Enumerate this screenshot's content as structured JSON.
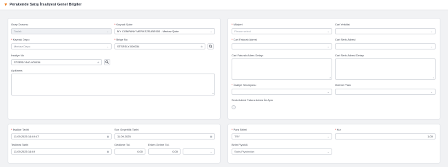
{
  "header": {
    "title": "Perakende Satış İrsaliyesi Genel Bilgiler"
  },
  "left_top": {
    "onay_durumu": {
      "label": "Onay Durumu",
      "value": "Taslak"
    },
    "kaynak_sube": {
      "label": "Kaynak Şube",
      "value": "MY COMPANY MERKEZSUBE000 - Merkez Şube"
    },
    "kaynak_depo": {
      "label": "Kaynak Depo",
      "value": "Merkez Depo"
    },
    "belge_no": {
      "label": "Belge No",
      "value": "STSRSLY-000034"
    },
    "irsaliye_no": {
      "label": "İrsaliye No",
      "value": "STSRSLYNO-000034"
    },
    "aciklama": {
      "label": "Açıklama"
    }
  },
  "right_top": {
    "musteri": {
      "label": "Müşteri",
      "placeholder": "Please select"
    },
    "cari_yetkilisi": {
      "label": "Cari Yetkilisi"
    },
    "cari_fatura_adresi": {
      "label": "Cari Faturalı Adresi"
    },
    "cari_sevk_adresi": {
      "label": "Cari Sevk Adresi"
    },
    "cari_fatura_adres_detayi": {
      "label": "Cari Faturalı Adres Detayı"
    },
    "cari_sevk_adres_detayi": {
      "label": "Cari Sevk Adresi Detayı"
    },
    "irsaliye_senaryosu": {
      "label": "İrsaliye Senaryosu"
    },
    "odeme_plani": {
      "label": "Ödeme Planı"
    },
    "sevk_ayni": {
      "label": "Sevk Adresi Fatura Adresi İle Aynı"
    }
  },
  "left_bottom": {
    "irsaliye_tarihi": {
      "label": "İrsaliye Tarihi",
      "value": "11.09.2025 14:49:47"
    },
    "son_gecerlilik": {
      "label": "Son Geçerlilik Tarihi",
      "value": "11.09.2025"
    },
    "teslimat_tarihi": {
      "label": "Teslimat Tarihi",
      "value": "11.09.2025 14:49"
    },
    "gecikme_tol": {
      "label": "Gecikme Tol.",
      "value": "0,00"
    },
    "erken_gelme_tol": {
      "label": "Erken Gelme Tol.",
      "value": "0,00"
    }
  },
  "right_bottom": {
    "para_birimi": {
      "label": "Para Birimi",
      "value": "TRY"
    },
    "kur": {
      "label": "Kur",
      "value": "1,00"
    },
    "birim_fiyat_al": {
      "label": "Birim Fiyat Al",
      "value": "Satış Fiyatından"
    }
  },
  "colors": {
    "accent": "#f07c1a",
    "required": "#e02424",
    "border": "#d9dce1"
  }
}
